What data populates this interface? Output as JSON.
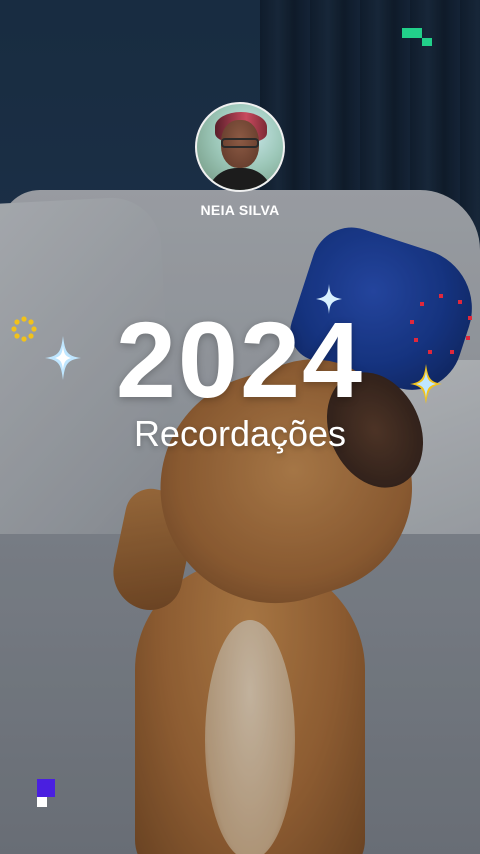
{
  "profile": {
    "name": "NEIA SILVA"
  },
  "headline": {
    "year": "2024",
    "subtitle": "Recordações"
  },
  "colors": {
    "accent_green": "#22d08a",
    "accent_purple": "#4a1fe0",
    "accent_red": "#e0283c",
    "accent_yellow": "#f2c21a"
  },
  "icons": [
    "sparkle-icon",
    "sun-ring-icon",
    "dotted-circle-icon",
    "pixel-block-icon"
  ]
}
